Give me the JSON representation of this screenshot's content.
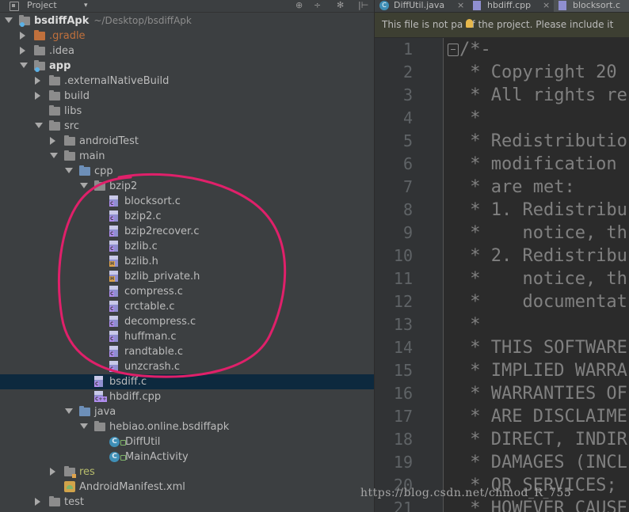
{
  "project_bar": {
    "label": "Project",
    "tool_buttons": [
      "⊕",
      "÷",
      "✻",
      "|⊢"
    ]
  },
  "tree": [
    {
      "label": "bsdiffApk",
      "path": "~/Desktop/bsdiffApk",
      "kind": "module",
      "expanded": true,
      "bold": true
    },
    {
      "label": ".gradle",
      "kind": "folder-orange",
      "expanded": false
    },
    {
      "label": ".idea",
      "kind": "folder",
      "expanded": false
    },
    {
      "label": "app",
      "kind": "module-folder",
      "expanded": true,
      "bold": true
    },
    {
      "label": ".externalNativeBuild",
      "kind": "folder",
      "expanded": false
    },
    {
      "label": "build",
      "kind": "folder",
      "expanded": false
    },
    {
      "label": "libs",
      "kind": "folder"
    },
    {
      "label": "src",
      "kind": "folder",
      "expanded": true
    },
    {
      "label": "androidTest",
      "kind": "folder",
      "expanded": false
    },
    {
      "label": "main",
      "kind": "folder",
      "expanded": true
    },
    {
      "label": "cpp",
      "kind": "folder-blue",
      "expanded": true
    },
    {
      "label": "bzip2",
      "kind": "folder",
      "expanded": true
    },
    {
      "label": "blocksort.c",
      "kind": "c-file"
    },
    {
      "label": "bzip2.c",
      "kind": "c-file"
    },
    {
      "label": "bzip2recover.c",
      "kind": "c-file"
    },
    {
      "label": "bzlib.c",
      "kind": "c-file"
    },
    {
      "label": "bzlib.h",
      "kind": "h-file"
    },
    {
      "label": "bzlib_private.h",
      "kind": "h-file"
    },
    {
      "label": "compress.c",
      "kind": "c-file"
    },
    {
      "label": "crctable.c",
      "kind": "c-file"
    },
    {
      "label": "decompress.c",
      "kind": "c-file"
    },
    {
      "label": "huffman.c",
      "kind": "c-file"
    },
    {
      "label": "randtable.c",
      "kind": "c-file"
    },
    {
      "label": "unzcrash.c",
      "kind": "c-file"
    },
    {
      "label": "bsdiff.c",
      "kind": "c-file",
      "selected": true
    },
    {
      "label": "hbdiff.cpp",
      "kind": "cpp-file"
    },
    {
      "label": "java",
      "kind": "folder-blue",
      "expanded": true
    },
    {
      "label": "hebiao.online.bsdiffapk",
      "kind": "folder",
      "expanded": true
    },
    {
      "label": "DiffUtil",
      "kind": "class"
    },
    {
      "label": "MainActivity",
      "kind": "class"
    },
    {
      "label": "res",
      "kind": "folder-res",
      "expanded": false
    },
    {
      "label": "AndroidManifest.xml",
      "kind": "manifest"
    },
    {
      "label": "test",
      "kind": "folder",
      "expanded": false
    }
  ],
  "tabs": [
    {
      "label": "DiffUtil.java",
      "icon": "java-class-icon",
      "active": false
    },
    {
      "label": "hbdiff.cpp",
      "icon": "cpp-file-icon",
      "active": false
    },
    {
      "label": "blocksort.c",
      "icon": "c-file-icon",
      "active": true
    }
  ],
  "notice": "This file is not pa   of the project. Please include it",
  "editor": {
    "line_numbers": [
      "1",
      "2",
      "3",
      "4",
      "5",
      "6",
      "7",
      "8",
      "9",
      "10",
      "11",
      "12",
      "13",
      "14",
      "15",
      "16",
      "17",
      "18",
      "19",
      "20",
      "21"
    ],
    "lines": [
      "/*-",
      " * Copyright 20",
      " * All rights re",
      " *",
      " * Redistributio",
      " * modification",
      " * are met:",
      " * 1. Redistribu",
      " *    notice, th",
      " * 2. Redistribu",
      " *    notice, th",
      " *    documentat",
      " *",
      " * THIS SOFTWARE",
      " * IMPLIED WARRA",
      " * WARRANTIES OF",
      " * ARE DISCLAIME",
      " * DIRECT, INDIR",
      " * DAMAGES (INCL",
      " * OR SERVICES;",
      " * HOWEVER CAUSE"
    ]
  },
  "watermark": "https://blog.csdn.net/chmod_R_755",
  "colors": {
    "panel_bg": "#3c3f41",
    "editor_bg": "#2b2b2b",
    "selection": "#0d293e",
    "annotation_circle": "#e0206a",
    "comment_text": "#808080"
  }
}
